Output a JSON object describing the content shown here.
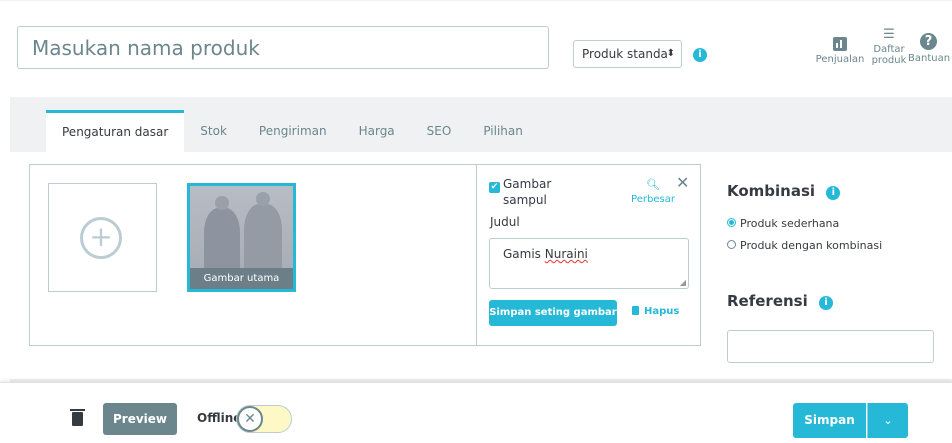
{
  "header": {
    "name_placeholder": "Masukan nama produk",
    "product_type": "Produk standa",
    "info_glyph": "i",
    "tools": [
      {
        "icon": "sales-icon",
        "label": "Penjualan"
      },
      {
        "icon": "list-icon",
        "label": "Daftar produk"
      },
      {
        "icon": "help-icon",
        "label": "Bantuan"
      }
    ]
  },
  "tabs": [
    "Pengaturan dasar",
    "Stok",
    "Pengiriman",
    "Harga",
    "SEO",
    "Pilihan"
  ],
  "active_tab": "Pengaturan dasar",
  "images": {
    "main_caption": "Gambar utama",
    "cover_label": "Gambar sampul",
    "zoom_label": "Perbesar",
    "title_label": "Judul",
    "title_value_prefix": "Gamis ",
    "title_value_misspelled": "Nuraini",
    "save_image_button": "Simpan seting gambar",
    "delete_button": "Hapus"
  },
  "combination": {
    "title": "Kombinasi",
    "options": [
      "Produk sederhana",
      "Produk dengan kombinasi"
    ],
    "selected": "Produk sederhana"
  },
  "reference": {
    "title": "Referensi",
    "value": ""
  },
  "footer": {
    "preview_button": "Preview",
    "offline_label": "Offline",
    "toggle_glyph": "✕",
    "save_button": "Simpan",
    "save_dropdown_glyph": "⌄"
  },
  "colors": {
    "accent": "#25b9d7",
    "muted": "#6c868e",
    "text": "#363a41",
    "toggle_off_bg": "#fef8c6"
  }
}
